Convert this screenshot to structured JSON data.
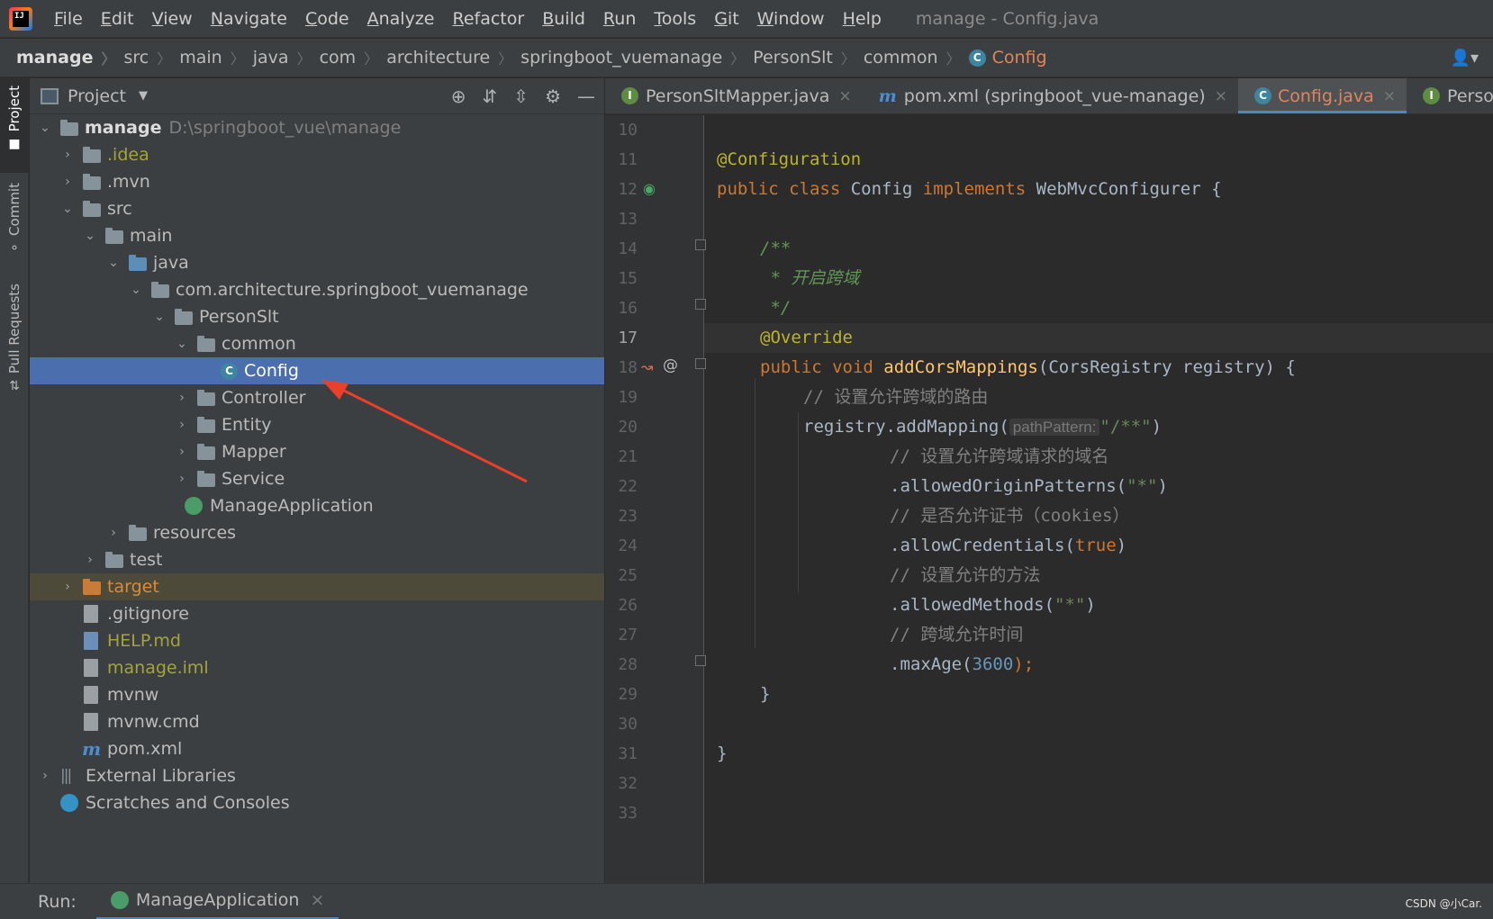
{
  "menubar": {
    "items": [
      "File",
      "Edit",
      "View",
      "Navigate",
      "Code",
      "Analyze",
      "Refactor",
      "Build",
      "Run",
      "Tools",
      "Git",
      "Window",
      "Help"
    ],
    "window_title": "manage - Config.java"
  },
  "breadcrumb": [
    "manage",
    "src",
    "main",
    "java",
    "com",
    "architecture",
    "springboot_vuemanage",
    "PersonSlt",
    "common",
    "Config"
  ],
  "left_strip": {
    "project": "Project",
    "commit": "Commit",
    "pull_requests": "Pull Requests"
  },
  "project_panel": {
    "title": "Project",
    "tree": [
      {
        "label": "manage",
        "extra": "D:\\springboot_vue\\manage"
      },
      {
        "label": ".idea"
      },
      {
        "label": ".mvn"
      },
      {
        "label": "src"
      },
      {
        "label": "main"
      },
      {
        "label": "java"
      },
      {
        "label": "com.architecture.springboot_vuemanage"
      },
      {
        "label": "PersonSlt"
      },
      {
        "label": "common"
      },
      {
        "label": "Config"
      },
      {
        "label": "Controller"
      },
      {
        "label": "Entity"
      },
      {
        "label": "Mapper"
      },
      {
        "label": "Service"
      },
      {
        "label": "ManageApplication"
      },
      {
        "label": "resources"
      },
      {
        "label": "test"
      },
      {
        "label": "target"
      },
      {
        "label": ".gitignore"
      },
      {
        "label": "HELP.md"
      },
      {
        "label": "manage.iml"
      },
      {
        "label": "mvnw"
      },
      {
        "label": "mvnw.cmd"
      },
      {
        "label": "pom.xml"
      },
      {
        "label": "External Libraries"
      },
      {
        "label": "Scratches and Consoles"
      }
    ]
  },
  "tabs": [
    {
      "label": "PersonSltMapper.java"
    },
    {
      "label": "pom.xml (springboot_vue-manage)"
    },
    {
      "label": "Config.java"
    },
    {
      "label": "PersonSltServic"
    }
  ],
  "editor": {
    "line_numbers": [
      "10",
      "11",
      "12",
      "13",
      "14",
      "15",
      "16",
      "17",
      "18",
      "19",
      "20",
      "21",
      "22",
      "23",
      "24",
      "25",
      "26",
      "27",
      "28",
      "29",
      "30",
      "31",
      "32",
      "33"
    ],
    "current_line": "17",
    "code": {
      "l11": "@Configuration",
      "l12_public": "public class ",
      "l12_name": "Config ",
      "l12_impl": "implements ",
      "l12_iface": "WebMvcConfigurer {",
      "l14": "/**",
      "l15": " * 开启跨域",
      "l16": " */",
      "l17": "@Override",
      "l18_kw": "public void ",
      "l18_fn": "addCorsMappings",
      "l18_rest": "(CorsRegistry registry) {",
      "l19": "// 设置允许跨域的路由",
      "l20_a": "registry.addMapping(",
      "l20_hint": "pathPattern:",
      "l20_str": "\"/**\"",
      "l20_b": ")",
      "l21": "// 设置允许跨域请求的域名",
      "l22_a": ".allowedOriginPatterns(",
      "l22_str": "\"*\"",
      "l22_b": ")",
      "l23": "// 是否允许证书（cookies）",
      "l24_a": ".allowCredentials(",
      "l24_kw": "true",
      "l24_b": ")",
      "l25": "// 设置允许的方法",
      "l26_a": ".allowedMethods(",
      "l26_str": "\"*\"",
      "l26_b": ")",
      "l27": "// 跨域允许时间",
      "l28_a": ".maxAge(",
      "l28_num": "3600",
      "l28_b": ");",
      "l29": "}",
      "l31": "}"
    }
  },
  "runbar": {
    "label": "Run:",
    "tab": "ManageApplication"
  },
  "watermark": "CSDN @小Car.",
  "colors": {
    "selection": "#4b6eaf",
    "accent": "#4a88c7",
    "arrow": "#e8402a"
  }
}
